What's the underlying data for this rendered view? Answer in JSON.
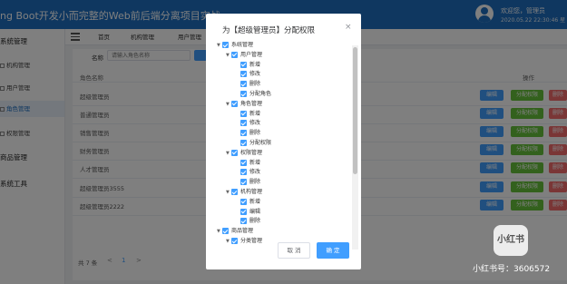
{
  "header": {
    "title": "ng Boot开发小而完整的Web前后端分离项目实战",
    "welcome": "欢迎您，管理员",
    "datetime": "2020.05.22 22:30:46 星"
  },
  "sidebar": {
    "groups": [
      {
        "label": "系统管理"
      },
      {
        "label": "商品管理"
      },
      {
        "label": "系统工具"
      }
    ],
    "items": [
      {
        "label": "机构管理"
      },
      {
        "label": "用户管理"
      },
      {
        "label": "角色管理"
      },
      {
        "label": "权限管理"
      }
    ]
  },
  "tabs": [
    "首页",
    "机构管理",
    "用户管理"
  ],
  "search": {
    "label": "名称",
    "placeholder": "请输入角色名称"
  },
  "table": {
    "col_name": "角色名称",
    "col_ops": "操作",
    "rows": [
      {
        "name": "超级管理员"
      },
      {
        "name": "普通管理员"
      },
      {
        "name": "销售管理员"
      },
      {
        "name": "财务管理员"
      },
      {
        "name": "人才管理员"
      },
      {
        "name": "超级管理员3555"
      },
      {
        "name": "超级管理员2222"
      }
    ],
    "edit_label": "编辑",
    "assign_label": "分配权限",
    "delete_label": "删除"
  },
  "pager": {
    "total": "共 7 条",
    "prev": "<",
    "page": "1",
    "next": ">"
  },
  "dialog": {
    "title": "为【超级管理员】分配权限",
    "close": "×",
    "cancel": "取 消",
    "confirm": "确 定",
    "tree": [
      {
        "label": "系统管理",
        "level": 0,
        "expanded": true
      },
      {
        "label": "用户管理",
        "level": 1,
        "expanded": true
      },
      {
        "label": "新增",
        "level": 2
      },
      {
        "label": "修改",
        "level": 2
      },
      {
        "label": "删除",
        "level": 2
      },
      {
        "label": "分配角色",
        "level": 2
      },
      {
        "label": "角色管理",
        "level": 1,
        "expanded": true
      },
      {
        "label": "新增",
        "level": 2
      },
      {
        "label": "修改",
        "level": 2
      },
      {
        "label": "删除",
        "level": 2
      },
      {
        "label": "分配权限",
        "level": 2
      },
      {
        "label": "权限管理",
        "level": 1,
        "expanded": true
      },
      {
        "label": "新增",
        "level": 2
      },
      {
        "label": "修改",
        "level": 2
      },
      {
        "label": "删除",
        "level": 2
      },
      {
        "label": "机构管理",
        "level": 1,
        "expanded": true
      },
      {
        "label": "新增",
        "level": 2
      },
      {
        "label": "编辑",
        "level": 2
      },
      {
        "label": "删除",
        "level": 2
      },
      {
        "label": "商品管理",
        "level": 0,
        "expanded": true
      },
      {
        "label": "分类管理",
        "level": 1,
        "expanded": true
      }
    ]
  },
  "watermark": {
    "logo": "小红书",
    "text": "小红书号：3606572"
  },
  "colors": {
    "header": "#1f6fc0",
    "primary": "#409eff",
    "success": "#67c23a",
    "danger": "#f56c6c"
  }
}
